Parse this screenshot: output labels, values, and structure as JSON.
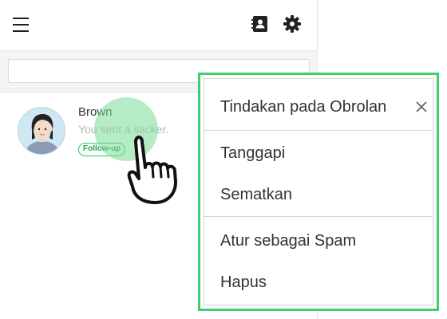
{
  "header": {
    "menu_icon": "hamburger-menu-icon",
    "contacts_icon": "contacts-book-icon",
    "settings_icon": "gear-icon"
  },
  "search": {
    "value": "",
    "placeholder": ""
  },
  "chat_list": [
    {
      "name": "Brown",
      "last_message": "You sent a sticker.",
      "tag": "Follow-up",
      "avatar": "user-avatar"
    }
  ],
  "context_menu": {
    "title": "Tindakan pada Obrolan",
    "close_icon": "close-icon",
    "items": [
      {
        "label": "Tanggapi"
      },
      {
        "label": "Sematkan"
      },
      {
        "label": "Atur sebagai Spam"
      },
      {
        "label": "Hapus"
      }
    ]
  },
  "colors": {
    "highlight_border": "#3fd06e",
    "tag_green": "#1ca64a",
    "touch_indicator": "#78dc96"
  }
}
